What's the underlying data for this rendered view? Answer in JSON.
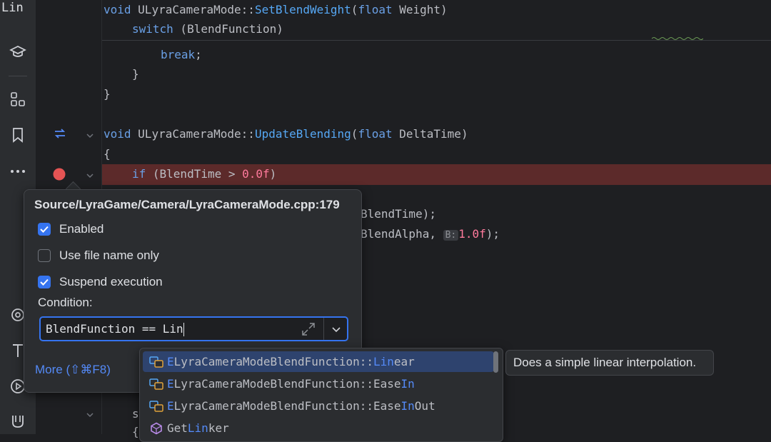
{
  "search_fragment": "Lin",
  "code_lines": {
    "sticky1": {
      "kw": "void",
      "cls": "ULyraCameraMode",
      "sep": "::",
      "fn": "SetBlendWeight",
      "p1": "(",
      "kw2": "float",
      "p2": " Weight)"
    },
    "sticky2": {
      "kw": "switch",
      "p": " (BlendFunction)"
    },
    "l_break": "break",
    "l_brace1": "}",
    "l_brace2": "}",
    "l_func": {
      "kw": "void",
      "cls": "ULyraCameraMode",
      "sep": "::",
      "fn": "UpdateBlending",
      "p1": "(",
      "kw2": "float",
      "p2": " DeltaTime)"
    },
    "l_open": "{",
    "l_if": {
      "kw": "if",
      "p1": " (BlendTime > ",
      "num": "0.0f",
      "p2": ")"
    },
    "l_a": "BlendTime);",
    "l_b1": "BlendAlpha, ",
    "l_b_hint": "B:",
    "l_b_num": "1.0f",
    "l_b2": ");",
    "l_s": "s",
    "l_brace3": "{"
  },
  "breakpoint_popup": {
    "title": "Source/LyraGame/Camera/LyraCameraMode.cpp:179",
    "enabled_label": "Enabled",
    "enabled_checked": true,
    "file_name_only_label": "Use file name only",
    "file_name_only_checked": false,
    "suspend_label": "Suspend execution",
    "suspend_checked": true,
    "condition_label": "Condition:",
    "condition_value": "BlendFunction == Lin",
    "more_link": "More (⇧⌘F8)"
  },
  "completion": {
    "items": [
      {
        "prefix": "E",
        "mid": "LyraCameraModeBlendFunction::",
        "match": "Lin",
        "rest": "ear",
        "selected": true
      },
      {
        "prefix": "E",
        "mid": "LyraCameraModeBlendFunction::Ease",
        "match": "In",
        "rest": "",
        "selected": false
      },
      {
        "prefix": "E",
        "mid": "LyraCameraModeBlendFunction::Ease",
        "match": "In",
        "rest": "Out",
        "selected": false
      },
      {
        "prefix": "Get",
        "mid": "",
        "match": "Lin",
        "rest": "ker",
        "selected": false
      }
    ],
    "doc": "Does a simple linear interpolation."
  },
  "colors": {
    "accent": "#3574f0",
    "breakpoint": "#e55454",
    "breakpoint_line": "#5c2a2a",
    "selection": "#2e436e"
  }
}
